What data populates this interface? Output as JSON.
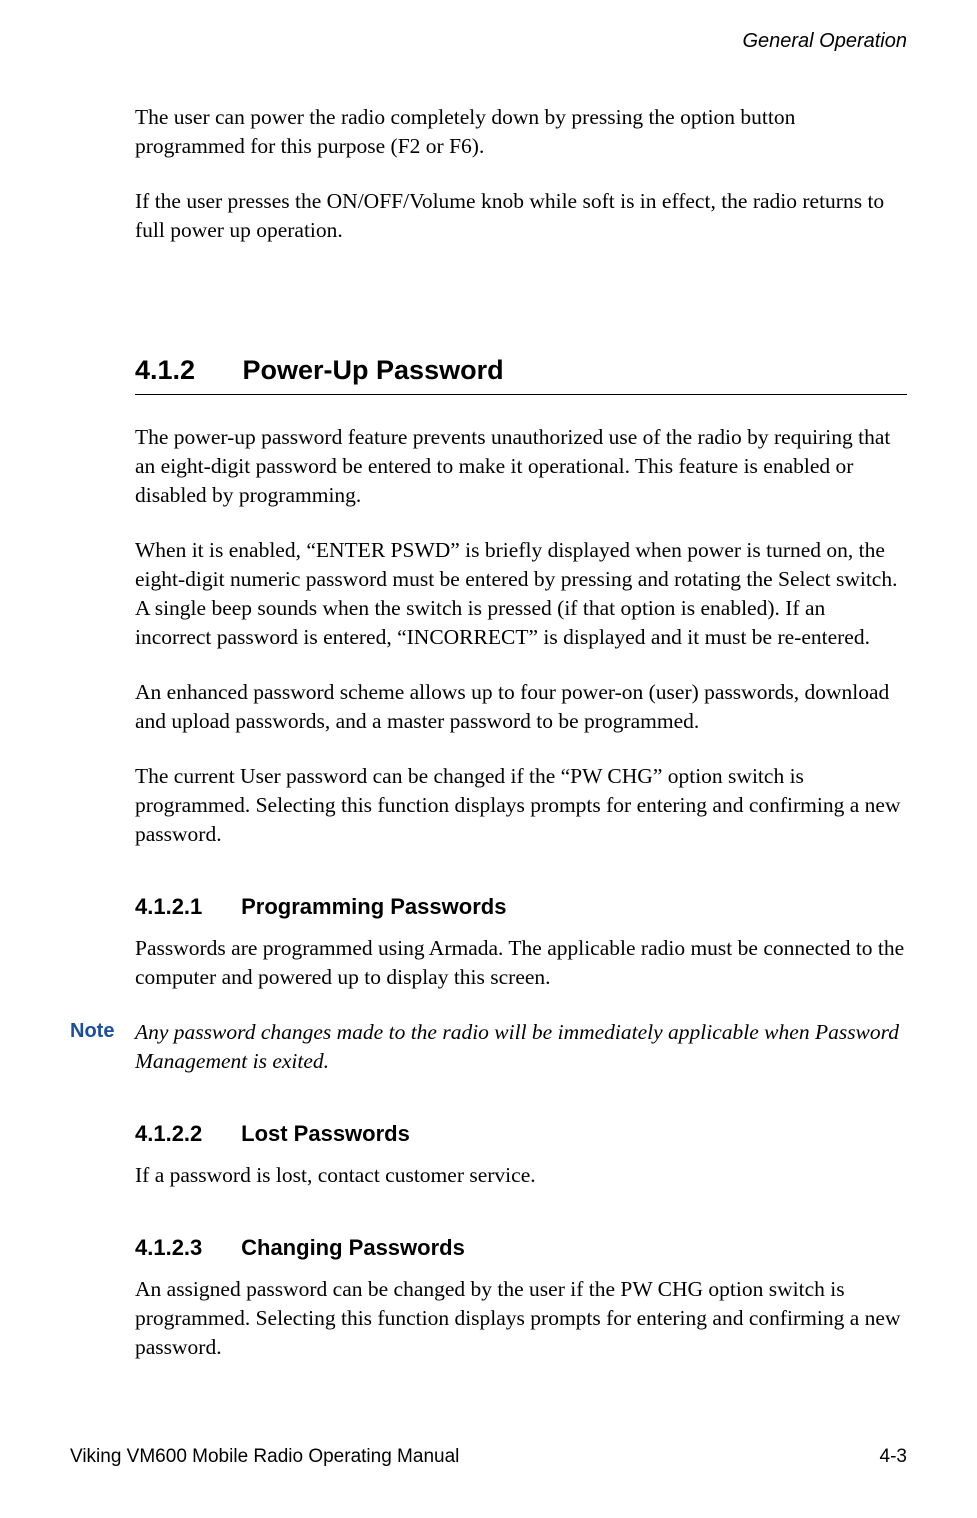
{
  "header": {
    "section": "General Operation"
  },
  "intro": {
    "p1": "The user can power the radio completely down by pressing the option button programmed for this purpose (F2 or F6).",
    "p2": "If the user presses the ON/OFF/Volume knob while soft is in effect, the radio returns to full power up operation."
  },
  "s412": {
    "num": "4.1.2",
    "title": "Power-Up Password",
    "p1": "The power-up password feature prevents unauthorized use of the radio by requiring that an eight-digit password be entered to make it operational. This feature is enabled or disabled by programming.",
    "p2": "When it is enabled, “ENTER PSWD” is briefly displayed when power is turned on, the eight-digit numeric password must be entered by pressing and rotating the Select switch. A single beep sounds when the switch is pressed (if that option is enabled). If an incorrect password is entered, “INCORRECT” is displayed and it must be re-entered.",
    "p3": "An enhanced password scheme allows up to four power-on (user) passwords, download and upload passwords, and a master password to be programmed.",
    "p4": "The current User password can be changed if the “PW CHG” option switch is programmed. Selecting this function displays prompts for entering and confirming a new password."
  },
  "s4121": {
    "num": "4.1.2.1",
    "title": "Programming Passwords",
    "p1": "Passwords are programmed using Armada. The applicable radio must be connected to the computer and powered up to display this screen.",
    "note_label": "Note",
    "note_text": "Any password changes made to the radio will be immediately applicable when Password Management is exited."
  },
  "s4122": {
    "num": "4.1.2.2",
    "title": "Lost Passwords",
    "p1": "If a password is lost, contact customer service."
  },
  "s4123": {
    "num": "4.1.2.3",
    "title": "Changing Passwords",
    "p1": "An assigned password can be changed by the user if the PW CHG option switch is programmed. Selecting this function displays prompts for entering and confirming a new password."
  },
  "footer": {
    "left": "Viking VM600 Mobile Radio Operating Manual",
    "right": "4-3"
  }
}
